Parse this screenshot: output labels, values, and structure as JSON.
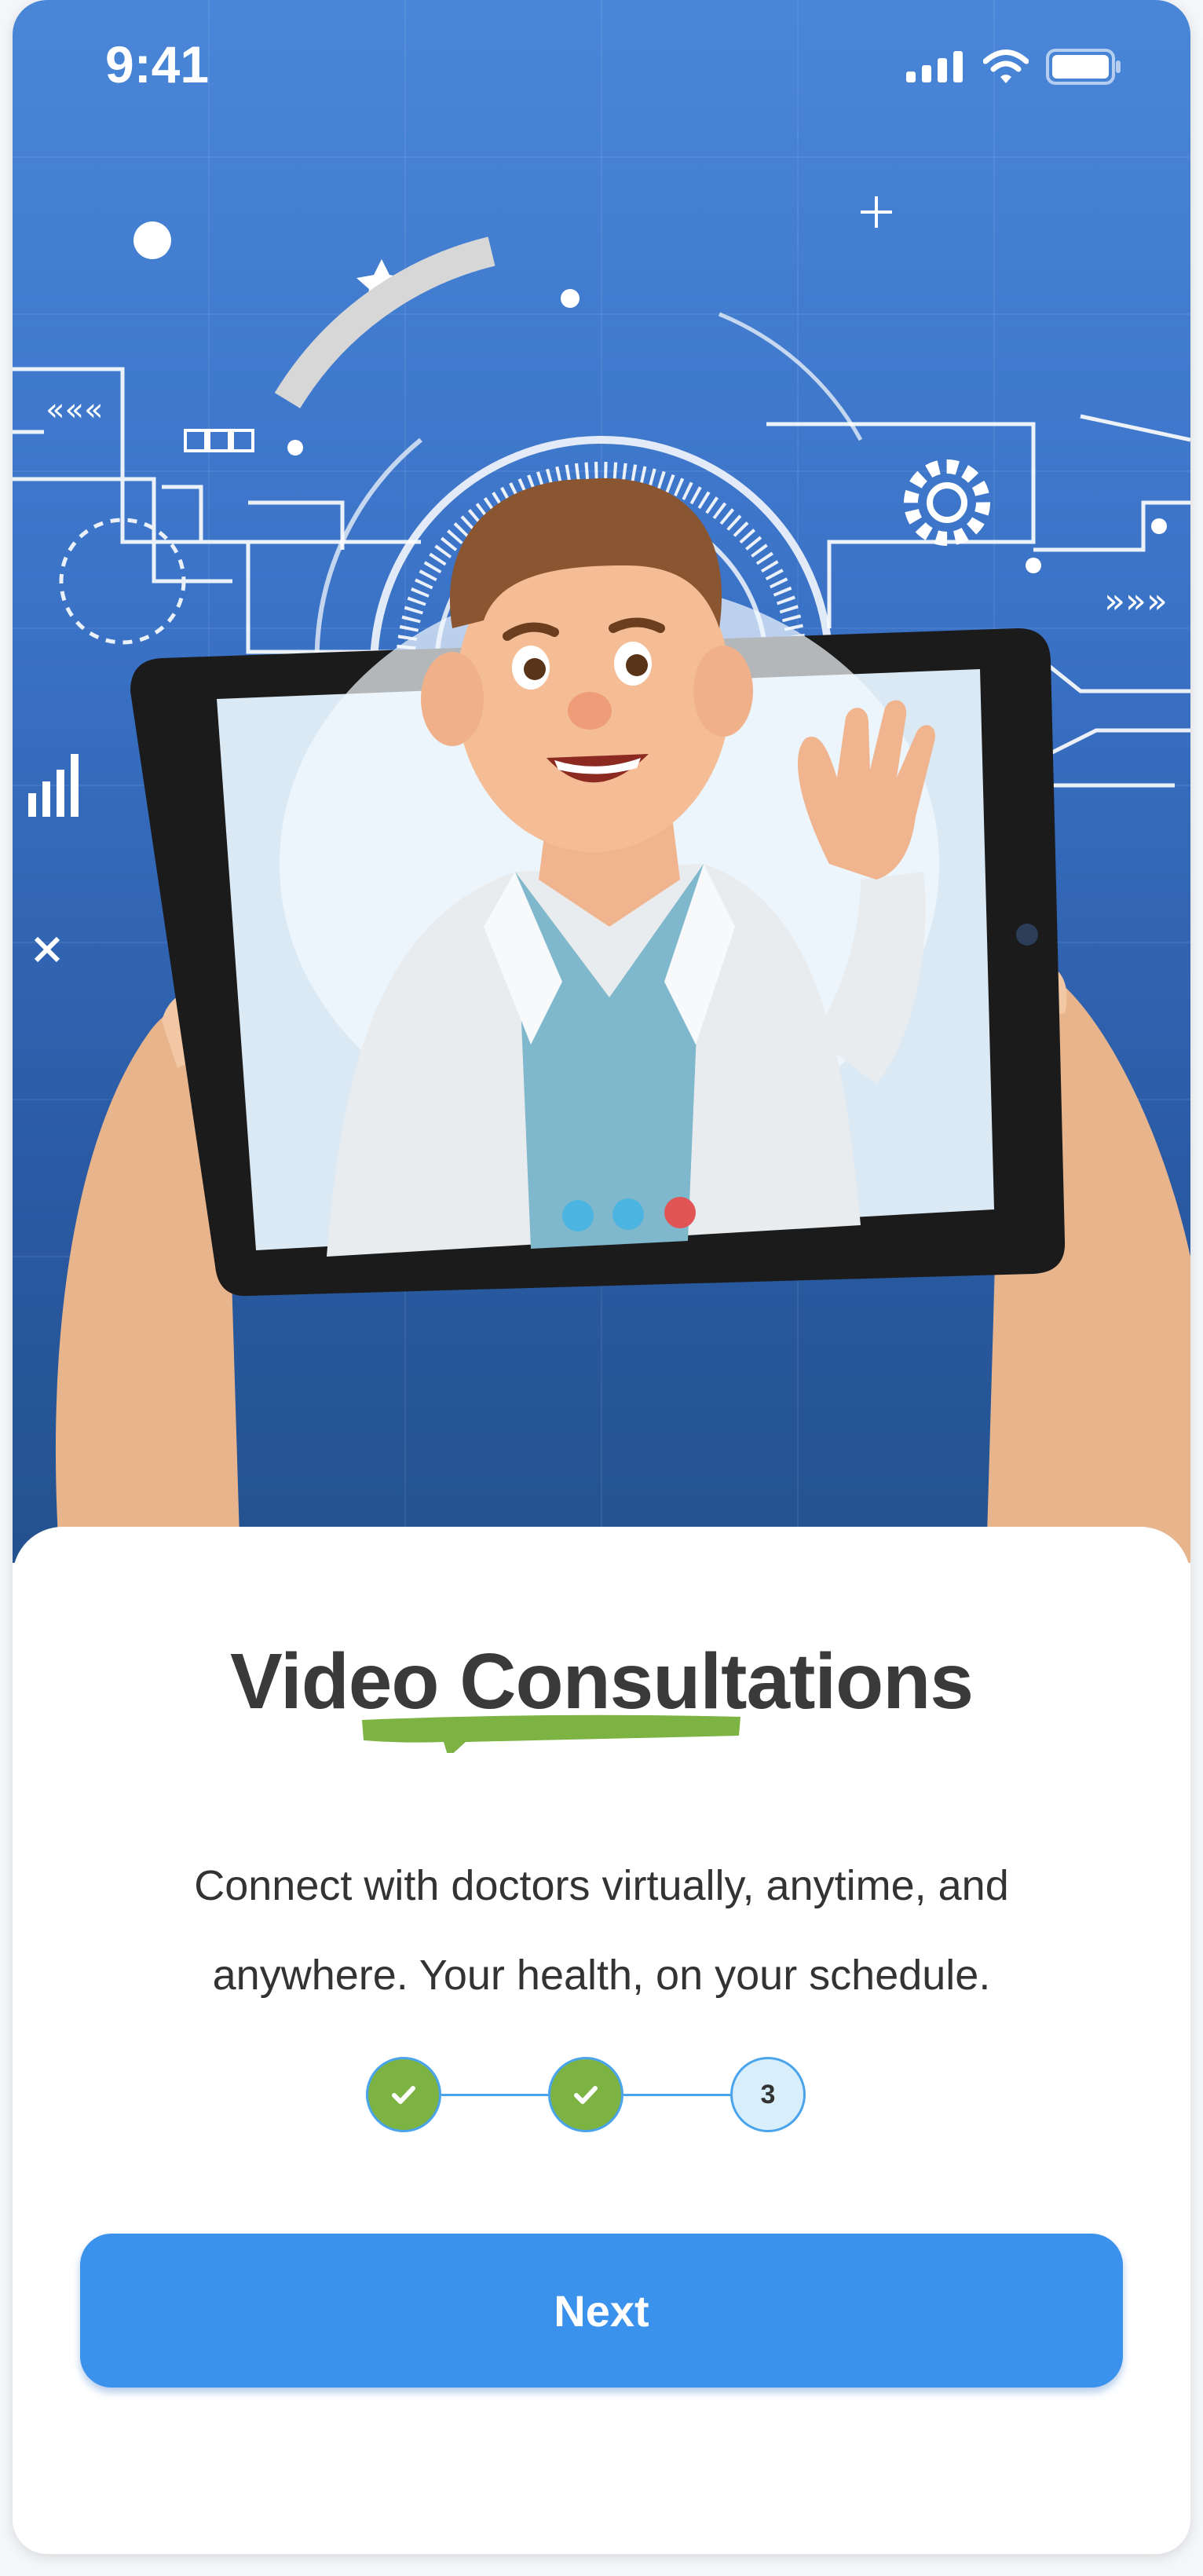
{
  "status_bar": {
    "time": "9:41"
  },
  "onboarding": {
    "title": "Video Consultations",
    "description_line1": "Connect with doctors virtually, anytime, and",
    "description_line2": "anywhere. Your health, on your schedule.",
    "steps": [
      {
        "state": "completed",
        "label": ""
      },
      {
        "state": "completed",
        "label": ""
      },
      {
        "state": "current",
        "label": "3"
      }
    ],
    "next_label": "Next"
  },
  "colors": {
    "hero_blue": "#3a72c6",
    "accent_green": "#7cb342",
    "button_blue": "#3b92ec",
    "step_outline": "#4aa4ec",
    "title_text": "#3a3a3a"
  }
}
